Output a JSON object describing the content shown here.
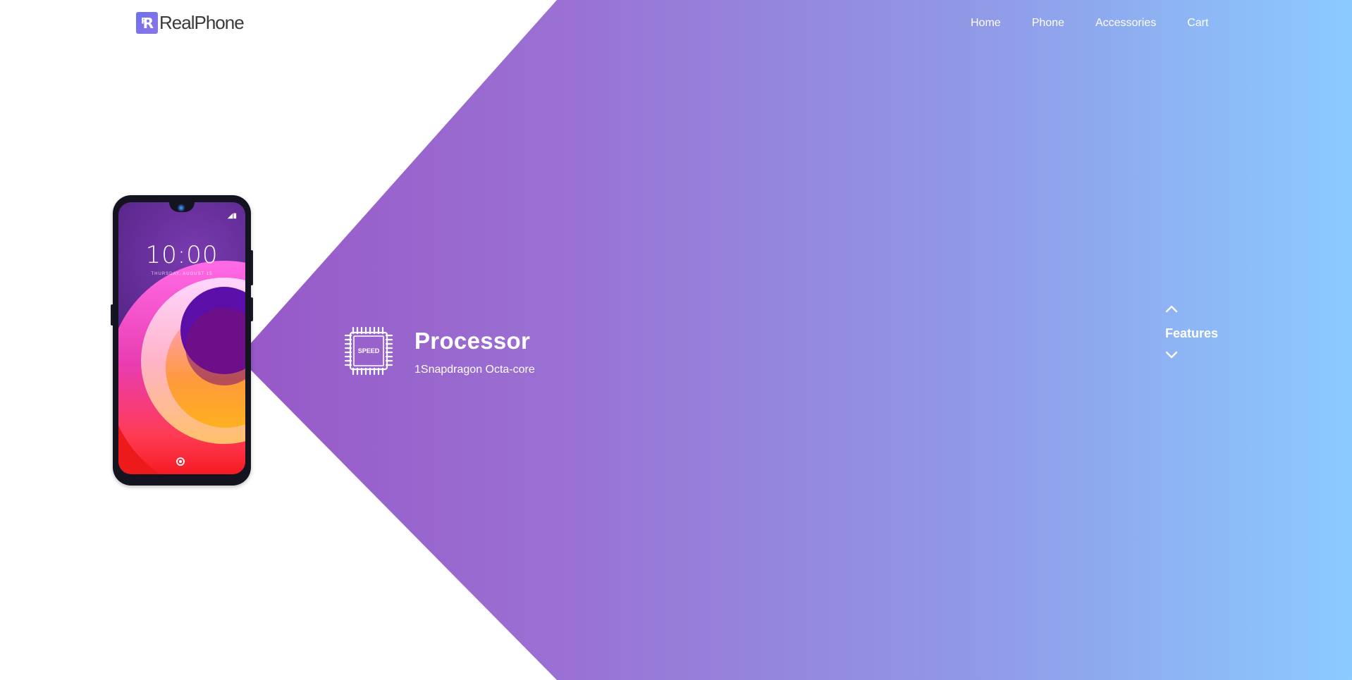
{
  "brand": {
    "mark": "R",
    "name": "RealPhone",
    "accent_color": "#6f6ff2"
  },
  "nav": {
    "items": [
      "Home",
      "Phone",
      "Accessories",
      "Cart"
    ]
  },
  "phone_screen": {
    "time": "10:00",
    "date": "THURSDAY, AUGUST 15"
  },
  "feature": {
    "icon_label": "SPEED",
    "title": "Processor",
    "description": "1Snapdragon Octa-core"
  },
  "side_nav": {
    "label": "Features",
    "up_icon": "chevron-up-icon",
    "down_icon": "chevron-down-icon"
  },
  "colors": {
    "gradient_start": "#9446bf",
    "gradient_mid": "#9099e6",
    "gradient_end": "#8bcbff"
  }
}
